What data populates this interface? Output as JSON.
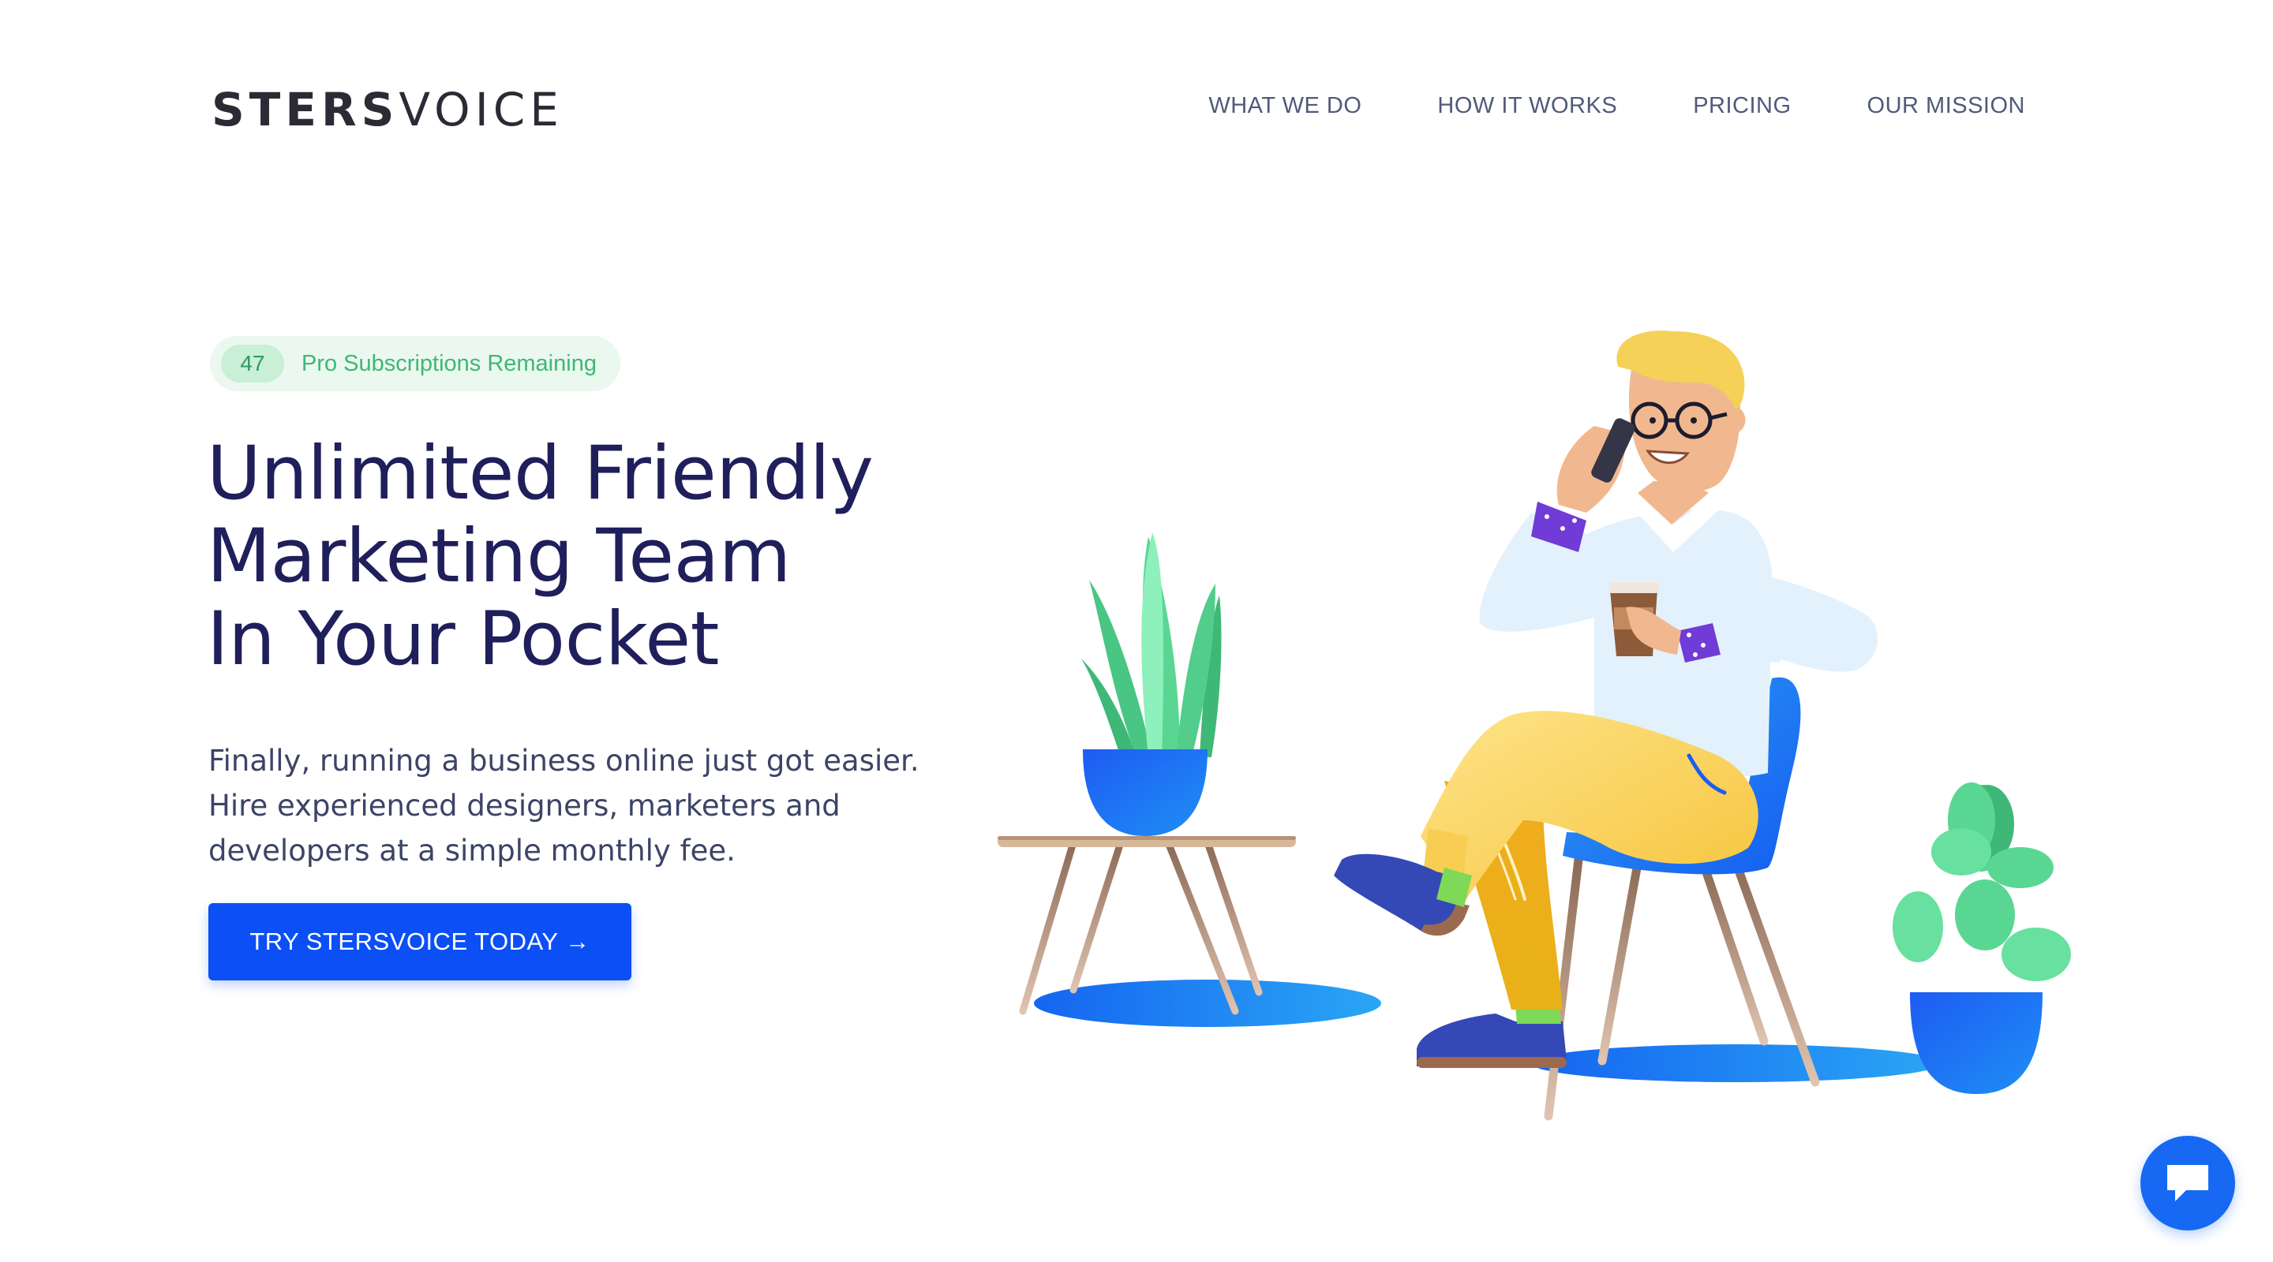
{
  "brand": {
    "logo_bold": "STERS",
    "logo_light": "VOICE"
  },
  "nav": {
    "items": [
      {
        "label": "WHAT WE DO"
      },
      {
        "label": "HOW IT WORKS"
      },
      {
        "label": "PRICING"
      },
      {
        "label": "OUR MISSION"
      }
    ]
  },
  "hero": {
    "badge": {
      "count": "47",
      "label": "Pro Subscriptions Remaining"
    },
    "headline_lines": [
      "Unlimited Friendly",
      "Marketing Team",
      "In Your Pocket"
    ],
    "subtext_lines": [
      "Finally, running a business online just got easier.",
      "Hire experienced designers, marketers and",
      "developers at a simple monthly fee."
    ],
    "cta_label": "TRY STERSVOICE TODAY →"
  },
  "illustration": {
    "subject": "man-on-phone-with-coffee-icon",
    "colors": {
      "accent_blue": "#1769f3",
      "pants": "#fcd86a",
      "shirt": "#e3f1fd",
      "plant_green": "#5ad693",
      "hair": "#f5d257"
    }
  },
  "chat_widget": {
    "icon": "chat-bubble-icon"
  },
  "colors": {
    "heading": "#1f1f5c",
    "nav": "#4f5a7a",
    "cta": "#0b4ff5",
    "badge_bg": "#eaf8ef",
    "badge_text": "#40b676"
  }
}
